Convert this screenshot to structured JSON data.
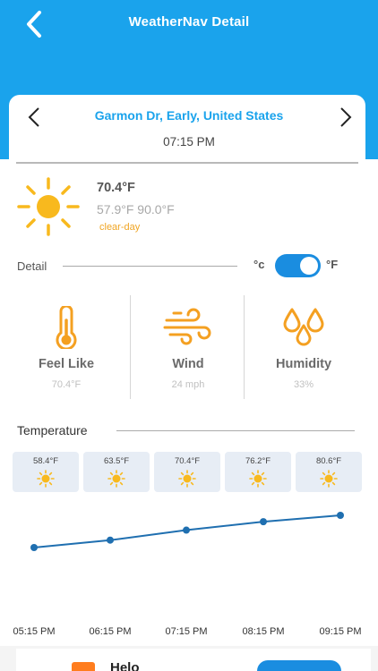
{
  "header": {
    "title": "WeatherNav Detail",
    "back_icon": "chevron-left-icon"
  },
  "location": {
    "name": "Garmon Dr, Early, United States",
    "time": "07:15 PM",
    "prev_icon": "chevron-left-icon",
    "next_icon": "chevron-right-icon"
  },
  "current": {
    "icon": "sun-icon",
    "temperature": "70.4°F",
    "low": "57.9°F",
    "high": "90.0°F",
    "condition": "clear-day"
  },
  "detail": {
    "label": "Detail",
    "unit_c": "°c",
    "unit_f": "°F",
    "toggle_on": true
  },
  "metrics": [
    {
      "title": "Feel Like",
      "value": "70.4°F",
      "icon": "thermometer-icon"
    },
    {
      "title": "Wind",
      "value": "24 mph",
      "icon": "wind-icon"
    },
    {
      "title": "Humidity",
      "value": "33%",
      "icon": "water-drops-icon"
    }
  ],
  "temperature_section": {
    "label": "Temperature"
  },
  "forecast": [
    {
      "temp": "58.4°F",
      "icon": "sun-icon"
    },
    {
      "temp": "63.5°F",
      "icon": "sun-icon"
    },
    {
      "temp": "70.4°F",
      "icon": "sun-icon"
    },
    {
      "temp": "76.2°F",
      "icon": "sun-icon"
    },
    {
      "temp": "80.6°F",
      "icon": "sun-icon"
    }
  ],
  "chart_data": {
    "type": "line",
    "x": [
      "05:15 PM",
      "06:15 PM",
      "07:15 PM",
      "08:15 PM",
      "09:15 PM"
    ],
    "values": [
      58.4,
      63.5,
      70.4,
      76.2,
      80.6
    ],
    "color": "#1f6fb0"
  },
  "ad": {
    "text": "Helo"
  },
  "colors": {
    "primary": "#1aa3ec",
    "accent_orange": "#f0a523",
    "toggle": "#1a8de0"
  }
}
